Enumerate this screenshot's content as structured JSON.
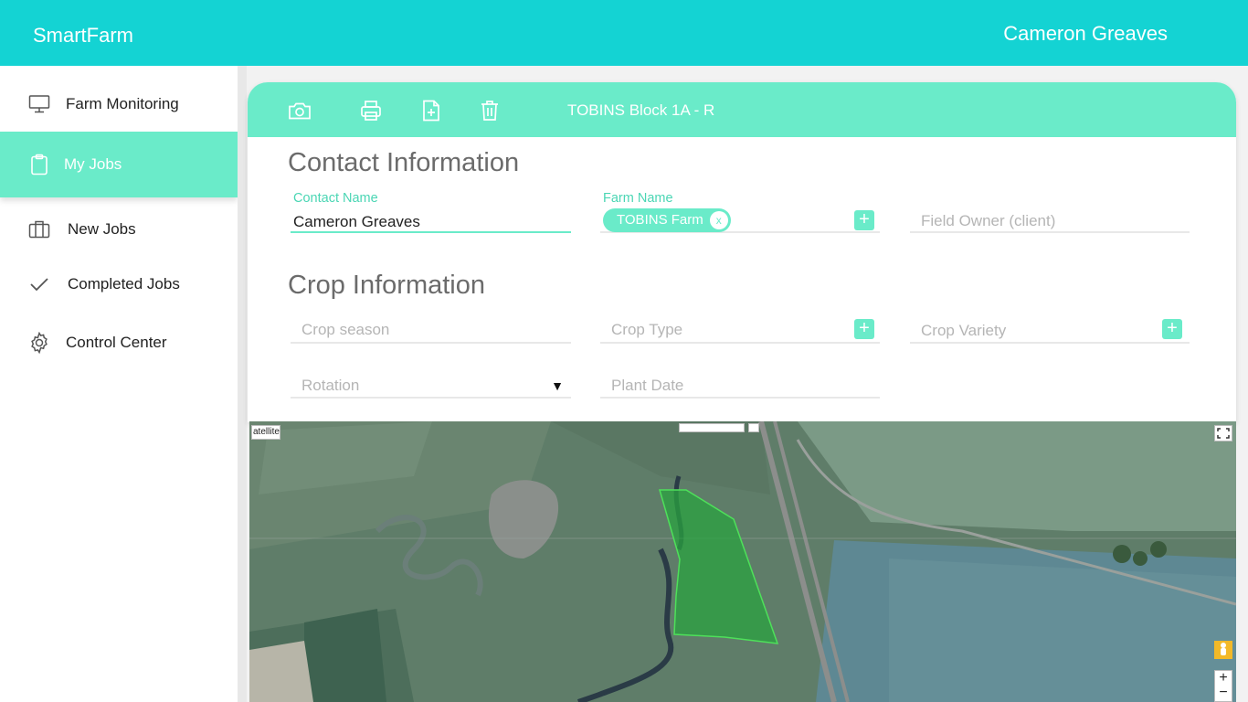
{
  "app": {
    "brand": "SmartFarm",
    "user": "Cameron Greaves"
  },
  "sidebar": {
    "items": [
      {
        "label": "Farm Monitoring",
        "icon": "monitor-icon"
      },
      {
        "label": "My Jobs",
        "icon": "clipboard-icon",
        "active": true
      },
      {
        "label": "New Jobs",
        "icon": "briefcase-icon"
      },
      {
        "label": "Completed Jobs",
        "icon": "check-icon"
      },
      {
        "label": "Control Center",
        "icon": "gear-icon"
      }
    ]
  },
  "card": {
    "title": "TOBINS Block 1A - R",
    "toolbar": [
      "camera-icon",
      "printer-icon",
      "add-file-icon",
      "trash-icon"
    ]
  },
  "contact": {
    "section_title": "Contact Information",
    "contact_name_label": "Contact Name",
    "contact_name_value": "Cameron Greaves",
    "farm_name_label": "Farm Name",
    "farm_chip": "TOBINS Farm",
    "farm_chip_remove": "x",
    "field_owner_placeholder": "Field Owner (client)"
  },
  "crop": {
    "section_title": "Crop Information",
    "season_placeholder": "Crop season",
    "type_placeholder": "Crop Type",
    "variety_placeholder": "Crop Variety",
    "rotation_placeholder": "Rotation",
    "plant_date_placeholder": "Plant Date"
  },
  "map": {
    "type_label": "atellite",
    "zoom_in": "+",
    "zoom_out": "−"
  },
  "colors": {
    "topbar": "#14d3d3",
    "accent": "#6aebc9",
    "field_polygon": "#2aa340"
  }
}
